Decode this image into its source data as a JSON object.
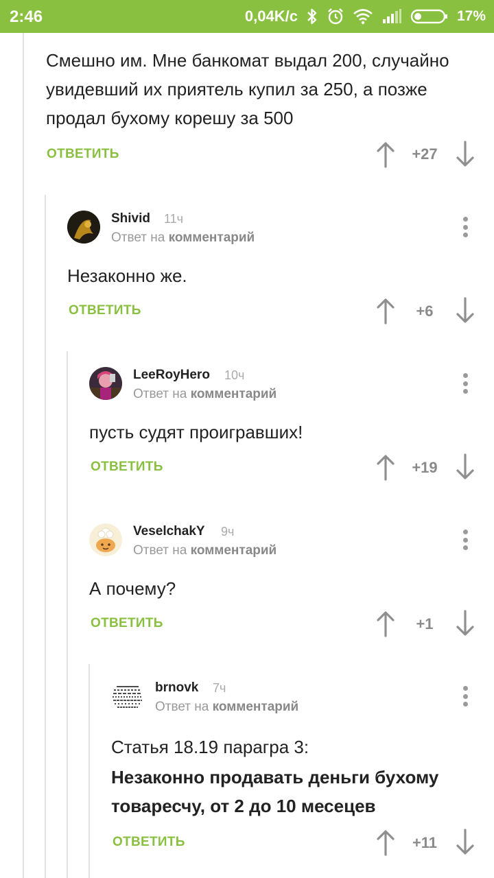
{
  "status_bar": {
    "time": "2:46",
    "network_speed": "0,04K/c",
    "battery": "17%",
    "background": "#8ac03f"
  },
  "ui": {
    "reply_label": "ОТВЕТИТЬ",
    "reply_prefix": "Ответ на",
    "reply_target": "комментарий",
    "accent_color": "#8ac03f"
  },
  "comments": [
    {
      "author": "",
      "time": "",
      "text": "Смешно им. Мне банкомат выдал 200, случайно увидевший их приятель купил за 250, а позже продал бухому корешу за 500",
      "score": "+27"
    },
    {
      "author": "Shivid",
      "time": "11ч",
      "text": "Незаконно же.",
      "score": "+6"
    },
    {
      "author": "LeeRoyHero",
      "time": "10ч",
      "text": "пусть судят проигравших!",
      "score": "+19"
    },
    {
      "author": "VeselchakY",
      "time": "9ч",
      "text": "А почему?",
      "score": "+1"
    },
    {
      "author": "brnovk",
      "time": "7ч",
      "text": "Статья 18.19 парагра 3:",
      "text_bold": "Незаконно продавать деньги бухому товаресчу, от 2 до 10 месецев",
      "score": "+11"
    }
  ]
}
